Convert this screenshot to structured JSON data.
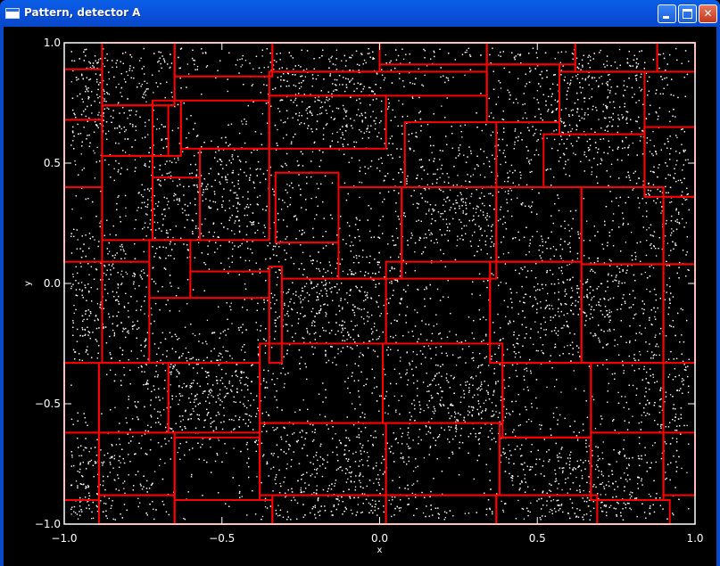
{
  "window": {
    "title": "Pattern, detector A",
    "buttons": {
      "minimize": "minimize-button",
      "maximize": "maximize-button",
      "close": "close-button"
    }
  },
  "colors": {
    "titlebar": "#0a52dd",
    "background": "#000000",
    "points": "#ffffff",
    "rectangles": "#ff0000",
    "axes": "#ffffff"
  },
  "chart_data": {
    "type": "scatter",
    "xlabel": "x",
    "ylabel": "y",
    "xlim": [
      -1.0,
      1.0
    ],
    "ylim": [
      -1.0,
      1.0
    ],
    "xticks": [
      -1.0,
      -0.5,
      0.0,
      0.5,
      1.0
    ],
    "xtick_labels": [
      "−1.0",
      "−0.5",
      "0.0",
      "0.5",
      "1.0"
    ],
    "yticks": [
      -1.0,
      -0.5,
      0.0,
      0.5,
      1.0
    ],
    "ytick_labels": [
      "−1.0",
      "−0.5",
      "0.0",
      "0.5",
      "1.0"
    ],
    "grid": false,
    "point_color": "#ffffff",
    "rect_color": "#ff0000",
    "pattern": "dense white scatter of points with alternating light/dark blob pattern (approx. 4 rows x 4 columns of brighter spots)",
    "rectangles": [
      [
        -0.88,
        0.74,
        -0.65,
        1.02
      ],
      [
        -0.65,
        0.86,
        -0.34,
        1.02
      ],
      [
        -0.34,
        0.88,
        0.0,
        1.02
      ],
      [
        0.0,
        0.91,
        0.34,
        1.02
      ],
      [
        0.34,
        0.91,
        0.62,
        1.02
      ],
      [
        0.62,
        0.88,
        0.88,
        1.02
      ],
      [
        0.88,
        0.88,
        1.02,
        1.02
      ],
      [
        -1.02,
        0.68,
        -0.88,
        0.89
      ],
      [
        -0.88,
        0.53,
        -0.67,
        0.74
      ],
      [
        -0.72,
        0.53,
        -0.63,
        0.76
      ],
      [
        -0.63,
        0.56,
        -0.35,
        0.76
      ],
      [
        -0.35,
        0.56,
        0.02,
        0.78
      ],
      [
        -0.35,
        0.78,
        0.34,
        0.88
      ],
      [
        0.08,
        0.4,
        0.37,
        0.67
      ],
      [
        0.34,
        0.67,
        0.57,
        0.91
      ],
      [
        0.57,
        0.62,
        0.84,
        0.88
      ],
      [
        0.52,
        0.4,
        0.84,
        0.62
      ],
      [
        0.84,
        0.36,
        1.02,
        0.65
      ],
      [
        -1.02,
        0.4,
        -0.88,
        0.68
      ],
      [
        -0.88,
        0.18,
        -0.72,
        0.53
      ],
      [
        -0.72,
        0.18,
        -0.57,
        0.44
      ],
      [
        -0.57,
        0.18,
        -0.35,
        0.56
      ],
      [
        -0.33,
        0.17,
        -0.13,
        0.46
      ],
      [
        -0.13,
        0.02,
        0.07,
        0.4
      ],
      [
        0.07,
        0.02,
        0.37,
        0.4
      ],
      [
        0.37,
        0.09,
        0.64,
        0.4
      ],
      [
        0.64,
        0.08,
        0.9,
        0.4
      ],
      [
        0.9,
        0.08,
        1.02,
        0.36
      ],
      [
        -1.02,
        0.09,
        -0.88,
        0.4
      ],
      [
        -0.88,
        -0.33,
        -0.73,
        0.09
      ],
      [
        -0.73,
        -0.06,
        -0.6,
        0.18
      ],
      [
        -0.6,
        -0.06,
        -0.35,
        0.05
      ],
      [
        -0.35,
        -0.33,
        -0.31,
        0.07
      ],
      [
        -0.31,
        -0.25,
        0.02,
        0.02
      ],
      [
        0.02,
        -0.25,
        0.35,
        0.09
      ],
      [
        0.35,
        -0.33,
        0.64,
        0.09
      ],
      [
        0.64,
        -0.33,
        0.9,
        0.08
      ],
      [
        0.9,
        -0.33,
        1.02,
        0.08
      ],
      [
        -1.02,
        -0.62,
        -0.89,
        -0.33
      ],
      [
        -0.89,
        -0.62,
        -0.67,
        -0.33
      ],
      [
        -0.67,
        -0.62,
        -0.38,
        -0.33
      ],
      [
        -0.38,
        -0.58,
        0.01,
        -0.25
      ],
      [
        0.01,
        -0.58,
        0.39,
        -0.25
      ],
      [
        0.39,
        -0.64,
        0.67,
        -0.33
      ],
      [
        0.67,
        -0.62,
        0.9,
        -0.33
      ],
      [
        -1.02,
        -0.9,
        -0.89,
        -0.62
      ],
      [
        -0.89,
        -0.88,
        -0.65,
        -0.62
      ],
      [
        -0.65,
        -0.9,
        -0.38,
        -0.64
      ],
      [
        -0.38,
        -0.88,
        0.02,
        -0.58
      ],
      [
        0.02,
        -0.88,
        0.38,
        -0.58
      ],
      [
        0.38,
        -0.88,
        0.67,
        -0.64
      ],
      [
        0.67,
        -0.9,
        0.9,
        -0.62
      ],
      [
        0.9,
        -0.88,
        1.02,
        -0.62
      ],
      [
        -0.89,
        -1.02,
        -0.65,
        -0.88
      ],
      [
        -0.65,
        -1.02,
        -0.34,
        -0.9
      ],
      [
        -0.34,
        -1.02,
        0.02,
        -0.88
      ],
      [
        0.02,
        -1.02,
        0.37,
        -0.88
      ],
      [
        0.37,
        -1.02,
        0.69,
        -0.88
      ],
      [
        0.69,
        -1.02,
        0.92,
        -0.9
      ]
    ]
  }
}
